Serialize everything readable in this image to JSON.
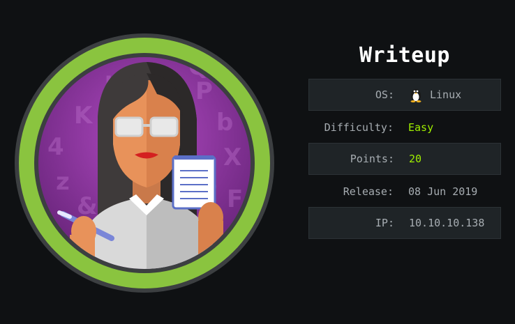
{
  "machine": {
    "name": "Writeup",
    "rows": [
      {
        "key": "OS:",
        "value": "Linux",
        "icon": "tux-icon"
      },
      {
        "key": "Difficulty:",
        "value": "Easy",
        "color": "#9fef00"
      },
      {
        "key": "Points:",
        "value": "20",
        "color": "#9fef00"
      },
      {
        "key": "Release:",
        "value": "08 Jun 2019"
      },
      {
        "key": "IP:",
        "value": "10.10.10.138"
      }
    ]
  },
  "colors": {
    "background": "#0f1113",
    "ring": "#8ac43f",
    "accent": "#9fef00",
    "row_box": "#1f2427",
    "avatar_bg": "#7a2a8a"
  }
}
